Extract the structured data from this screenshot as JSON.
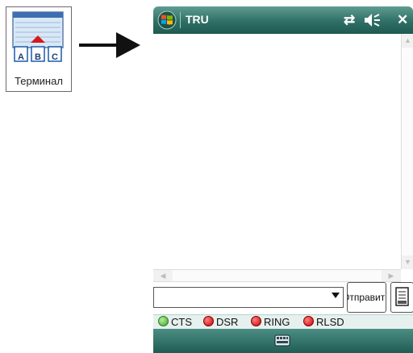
{
  "desktop_icon": {
    "label": "Терминал",
    "badges": [
      "A",
      "B",
      "C"
    ]
  },
  "window": {
    "title": "TRU",
    "icons": [
      "connectivity-icon",
      "volume-icon",
      "close-icon"
    ],
    "close_glyph": "✕"
  },
  "input": {
    "command_value": "",
    "send_label": "Отправить"
  },
  "status_indicators": [
    {
      "label": "CTS",
      "state": "on",
      "color": "#3f9f2a"
    },
    {
      "label": "DSR",
      "state": "off",
      "color": "#c40000"
    },
    {
      "label": "RING",
      "state": "off",
      "color": "#c40000"
    },
    {
      "label": "RLSD",
      "state": "off",
      "color": "#c40000"
    }
  ],
  "colors": {
    "titlebar": "#2f6f66",
    "status_bar": "#e6f1ef"
  }
}
